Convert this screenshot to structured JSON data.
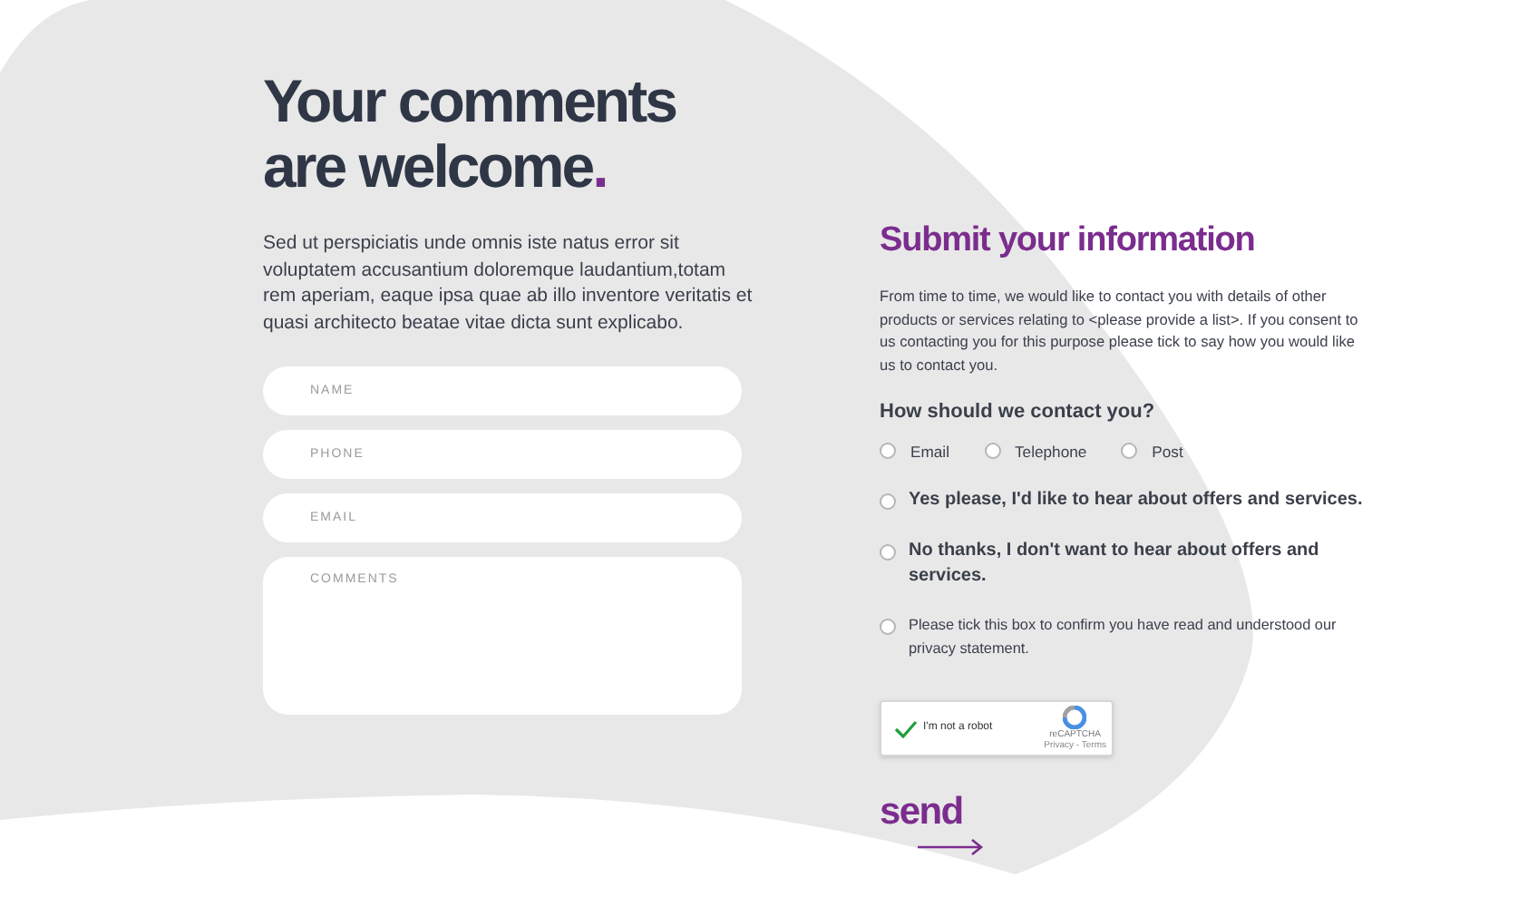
{
  "heading": {
    "text": "Your comments are welcome",
    "mark": "."
  },
  "intro": "Sed ut perspiciatis unde omnis iste natus error sit voluptatem accusantium doloremque laudantium,totam rem aperiam, eaque ipsa quae ab illo inventore veritatis et quasi architecto beatae vitae dicta sunt explicabo.",
  "fields": [
    {
      "kind": "line",
      "placeholder": "NAME"
    },
    {
      "kind": "line",
      "placeholder": "PHONE"
    },
    {
      "kind": "line",
      "placeholder": "EMAIL"
    },
    {
      "kind": "area",
      "placeholder": "COMMENTS"
    }
  ],
  "submit_title": "Submit your information",
  "consent_text": "From time to time, we would like to contact you with details of other products or services relating to <please provide a list>. If you consent to us contacting you for this purpose please tick to say how you would like us to contact you.",
  "contact_question": "How should we contact you?",
  "contact_options": [
    {
      "label": "Email",
      "selected": false
    },
    {
      "label": "Telephone",
      "selected": false
    },
    {
      "label": "Post",
      "selected": false
    }
  ],
  "offers": [
    {
      "kind": "bold",
      "label": "Yes please, I'd like to hear about offers and services.",
      "selected": false
    },
    {
      "kind": "bold",
      "label": "No thanks, I don't want to hear about offers and services.",
      "selected": false
    },
    {
      "kind": "plain",
      "label": "Please tick this box to confirm you have read and understood our privacy statement.",
      "selected": false
    }
  ],
  "captcha": {
    "label": "I'm not a robot",
    "checked": true,
    "brand": "reCAPTCHA",
    "links": "Privacy - Terms"
  },
  "send": "send"
}
